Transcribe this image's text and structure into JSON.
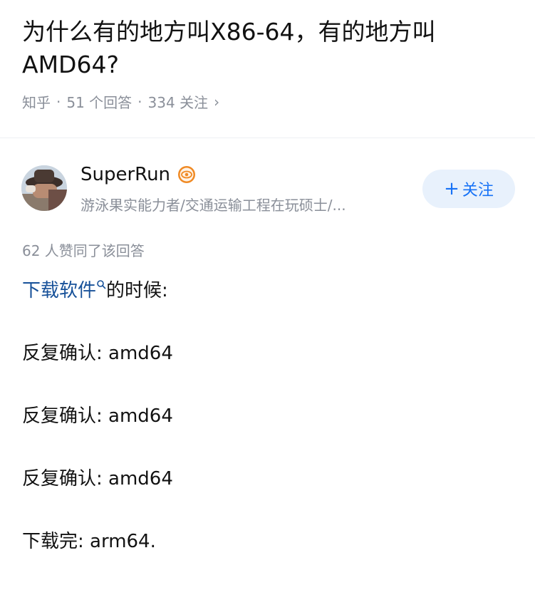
{
  "question": {
    "title": "为什么有的地方叫X86-64，有的地方叫AMD64?",
    "source": "知乎",
    "answers_count": "51 个回答",
    "followers_count": "334 关注",
    "separator": "·",
    "chevron": "›"
  },
  "author": {
    "name": "SuperRun",
    "badge_icon": "eye-badge-icon",
    "bio": "游泳果实能力者/交通运输工程在玩硕士/...",
    "follow_label": "关注",
    "follow_plus": "+"
  },
  "answer": {
    "votes": "62 人赞同了该回答",
    "link_text": "下载软件",
    "line1_suffix": "的时候:",
    "lines": [
      "反复确认: amd64",
      "反复确认: amd64",
      "反复确认: amd64",
      "下载完: arm64."
    ]
  },
  "colors": {
    "link": "#175199",
    "follow_bg": "#e8f1fc",
    "follow_text": "#1772f6",
    "meta": "#8a8f99",
    "badge": "#f08a24"
  }
}
